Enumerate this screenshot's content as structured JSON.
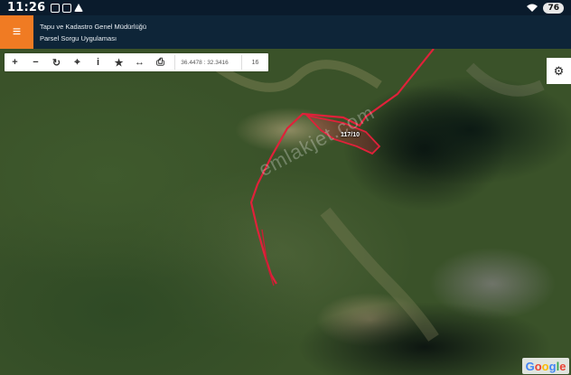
{
  "status_bar": {
    "time": "11:26",
    "battery": "76"
  },
  "header": {
    "menu_icon": "hamburger-icon",
    "title_line1": "Tapu ve Kadastro Genel Müdürlüğü",
    "title_line2": "Parsel Sorgu Uygulaması"
  },
  "toolbar": {
    "tools": [
      {
        "icon": "zoom-in-icon",
        "glyph": "+"
      },
      {
        "icon": "zoom-out-icon",
        "glyph": "−"
      },
      {
        "icon": "refresh-icon",
        "glyph": "↻"
      },
      {
        "icon": "locate-icon",
        "glyph": "⌖"
      },
      {
        "icon": "info-icon",
        "glyph": "i"
      },
      {
        "icon": "star-icon",
        "glyph": "★"
      },
      {
        "icon": "measure-icon",
        "glyph": "↔"
      },
      {
        "icon": "print-icon",
        "glyph": "⎙"
      }
    ],
    "coordinates": "36.4478 : 32.3416",
    "zoom_level": "16"
  },
  "map": {
    "parcel_label": "117/10",
    "watermark": "emlakjet.com",
    "parcel_color": "#e0213a",
    "attribution": [
      "G",
      "o",
      "o",
      "g",
      "l",
      "e"
    ]
  },
  "colors": {
    "accent": "#f07b23",
    "header_bg": "#0e2538"
  }
}
